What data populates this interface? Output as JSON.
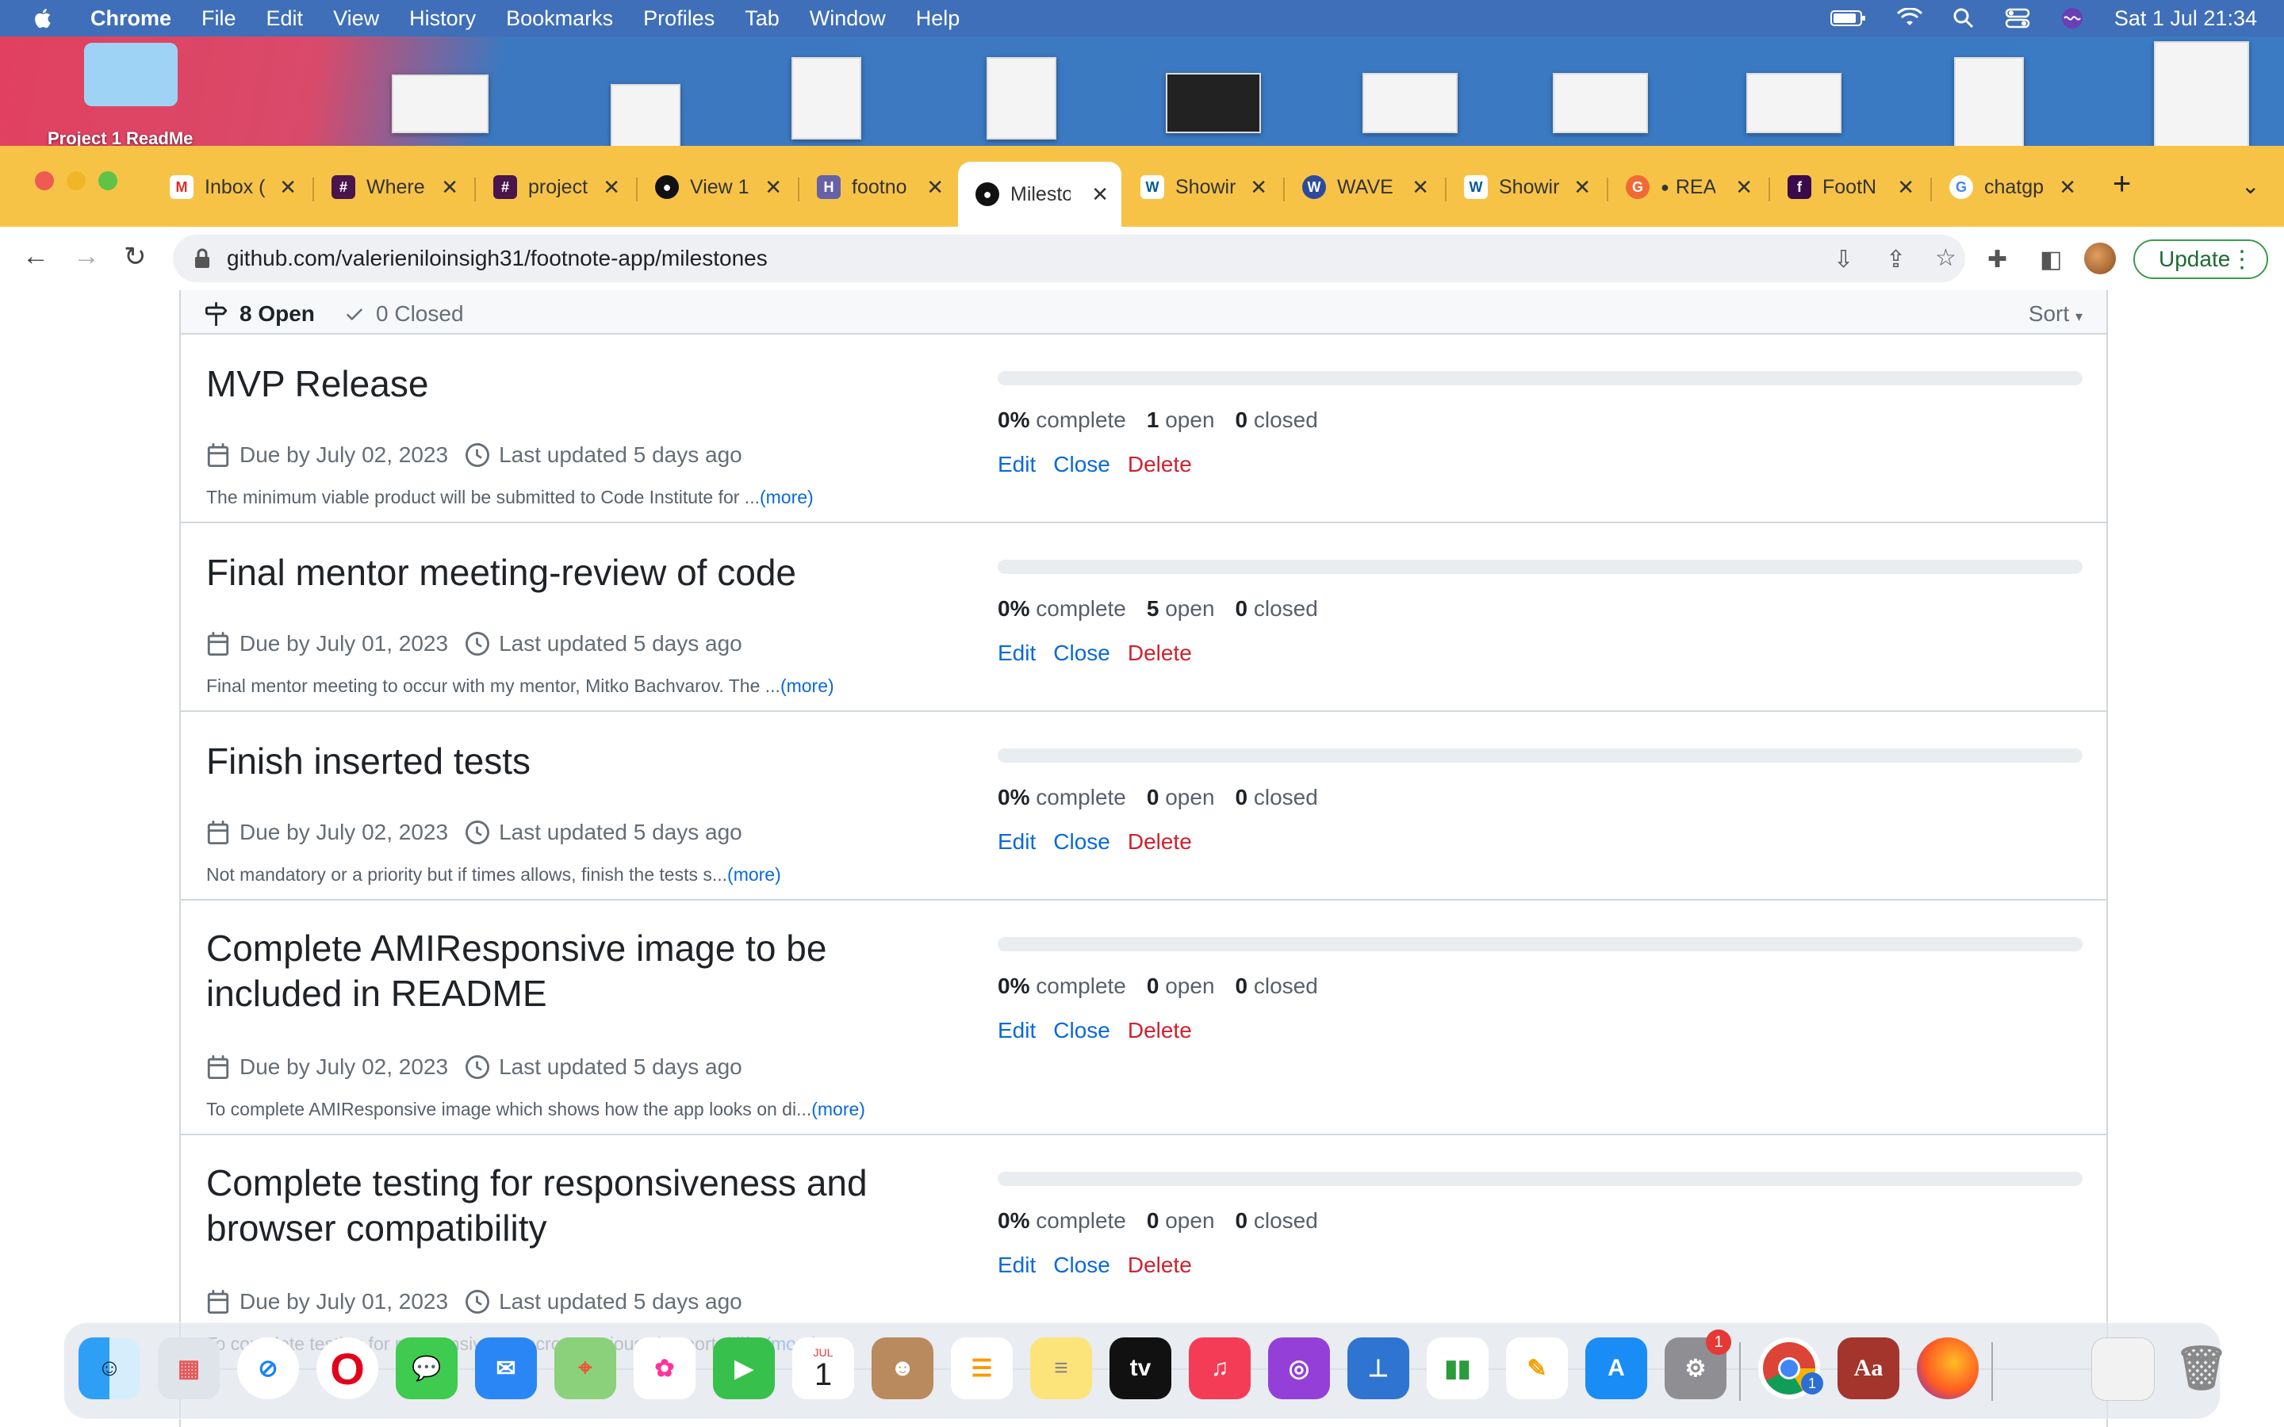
{
  "menubar": {
    "items": [
      "Chrome",
      "File",
      "Edit",
      "View",
      "History",
      "Bookmarks",
      "Profiles",
      "Tab",
      "Window",
      "Help"
    ],
    "datetime": "Sat 1 Jul  21:34"
  },
  "desktop": {
    "folder_label": "Project 1 ReadMe"
  },
  "tabs": [
    {
      "label": "Inbox (",
      "icon": "gmail-icon"
    },
    {
      "label": "Where",
      "icon": "slack-icon"
    },
    {
      "label": "project",
      "icon": "slack-icon"
    },
    {
      "label": "View 1",
      "icon": "github-icon"
    },
    {
      "label": "footno",
      "icon": "heroku-icon"
    },
    {
      "label": "Milesto",
      "icon": "github-icon",
      "active": true
    },
    {
      "label": "Showir",
      "icon": "w3c-icon"
    },
    {
      "label": "WAVE",
      "icon": "wave-icon"
    },
    {
      "label": "Showir",
      "icon": "w3c-icon"
    },
    {
      "label": "REA",
      "icon": "grammarly-icon"
    },
    {
      "label": "FootN",
      "icon": "footnote-icon"
    },
    {
      "label": "chatgp",
      "icon": "google-icon"
    }
  ],
  "address_bar": {
    "url": "github.com/valerieniloinsigh31/footnote-app/milestones"
  },
  "toolbar": {
    "update_label": "Update"
  },
  "milestones_header": {
    "open": "8 Open",
    "closed": "0 Closed",
    "sort": "Sort"
  },
  "milestones": [
    {
      "title": "MVP Release",
      "due": "Due by July 02, 2023",
      "updated": "Last updated 5 days ago",
      "description": "The minimum viable product will be submitted to Code Institute for ...",
      "more": "(more)",
      "percent": "0%",
      "complete_label": "complete",
      "open": "1",
      "open_label": "open",
      "closed": "0",
      "closed_label": "closed",
      "progress": 0
    },
    {
      "title": "Final mentor meeting-review of code",
      "due": "Due by July 01, 2023",
      "updated": "Last updated 5 days ago",
      "description": "Final mentor meeting to occur with my mentor, Mitko Bachvarov. The ...",
      "more": "(more)",
      "percent": "0%",
      "complete_label": "complete",
      "open": "5",
      "open_label": "open",
      "closed": "0",
      "closed_label": "closed",
      "progress": 0
    },
    {
      "title": "Finish inserted tests",
      "due": "Due by July 02, 2023",
      "updated": "Last updated 5 days ago",
      "description": "Not mandatory or a priority but if times allows, finish the tests s...",
      "more": "(more)",
      "percent": "0%",
      "complete_label": "complete",
      "open": "0",
      "open_label": "open",
      "closed": "0",
      "closed_label": "closed",
      "progress": 0
    },
    {
      "title": "Complete AMIResponsive image to be included in README",
      "due": "Due by July 02, 2023",
      "updated": "Last updated 5 days ago",
      "description": "To complete AMIResponsive image which shows how the app looks on di...",
      "more": "(more)",
      "percent": "0%",
      "complete_label": "complete",
      "open": "0",
      "open_label": "open",
      "closed": "0",
      "closed_label": "closed",
      "progress": 0
    },
    {
      "title": "Complete testing for responsiveness and browser compatibility",
      "due": "Due by July 01, 2023",
      "updated": "Last updated 5 days ago",
      "description": "To complete testing for respsonsivenss across various viewports/dif...",
      "more": "(more)",
      "percent": "0%",
      "complete_label": "complete",
      "open": "0",
      "open_label": "open",
      "closed": "0",
      "closed_label": "closed",
      "progress": 0
    }
  ],
  "actions": {
    "edit": "Edit",
    "close": "Close",
    "delete": "Delete"
  },
  "dock": {
    "calendar_month": "JUL",
    "calendar_day": "1",
    "tv_label": "tv",
    "settings_badge": "1",
    "chrome_badge": "1",
    "dictionary_label": "Aa"
  }
}
